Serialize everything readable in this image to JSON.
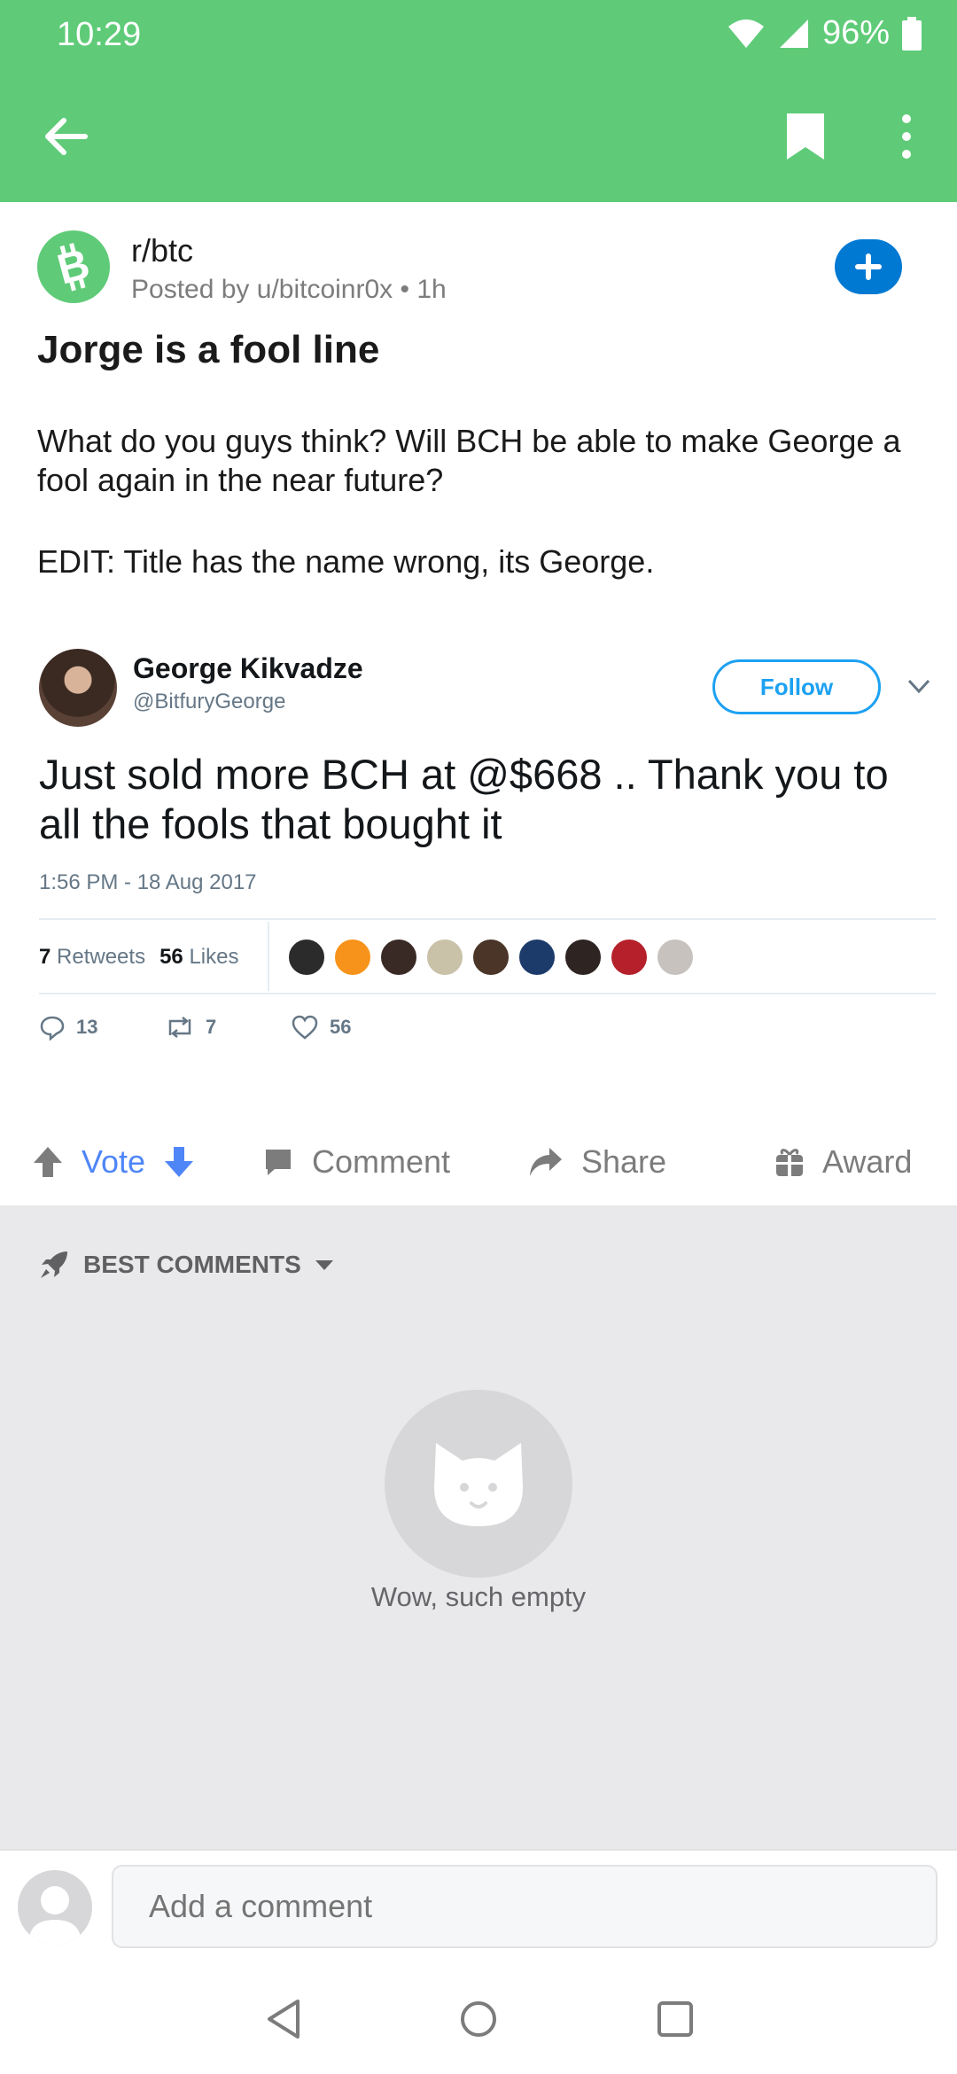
{
  "status": {
    "time": "10:29",
    "battery": "96%"
  },
  "post": {
    "subreddit": "r/btc",
    "meta": "Posted by u/bitcoinr0x • 1h",
    "title": "Jorge is a fool line",
    "body": [
      "What do you guys think? Will BCH be able to make George a fool again in the near future?",
      "EDIT: Title has the name wrong, its George."
    ]
  },
  "tweet": {
    "name": "George Kikvadze",
    "handle": "@BitfuryGeorge",
    "follow_label": "Follow",
    "text": "Just sold more BCH at @$668 .. Thank you to all the fools that bought it",
    "date": "1:56 PM - 18 Aug 2017",
    "retweets_count": "7",
    "retweets_label": "Retweets",
    "likes_count": "56",
    "likes_label": "Likes",
    "reply_count": "13",
    "retweet_count": "7",
    "like_count": "56",
    "liker_colors": [
      "#2b2b2b",
      "#f7931a",
      "#3a2a25",
      "#c9c1a8",
      "#4a3528",
      "#1c3b6b",
      "#2e2523",
      "#b5202b",
      "#c7c2be"
    ]
  },
  "actions": {
    "vote": "Vote",
    "comment": "Comment",
    "share": "Share",
    "award": "Award"
  },
  "comments": {
    "sort_label": "BEST COMMENTS",
    "empty_text": "Wow, such empty"
  },
  "composer": {
    "placeholder": "Add a comment"
  },
  "colors": {
    "brand_green": "#5fcb78",
    "join_blue": "#0079d3",
    "vote_blue": "#4f86f7",
    "twitter_blue": "#1da1f2"
  }
}
